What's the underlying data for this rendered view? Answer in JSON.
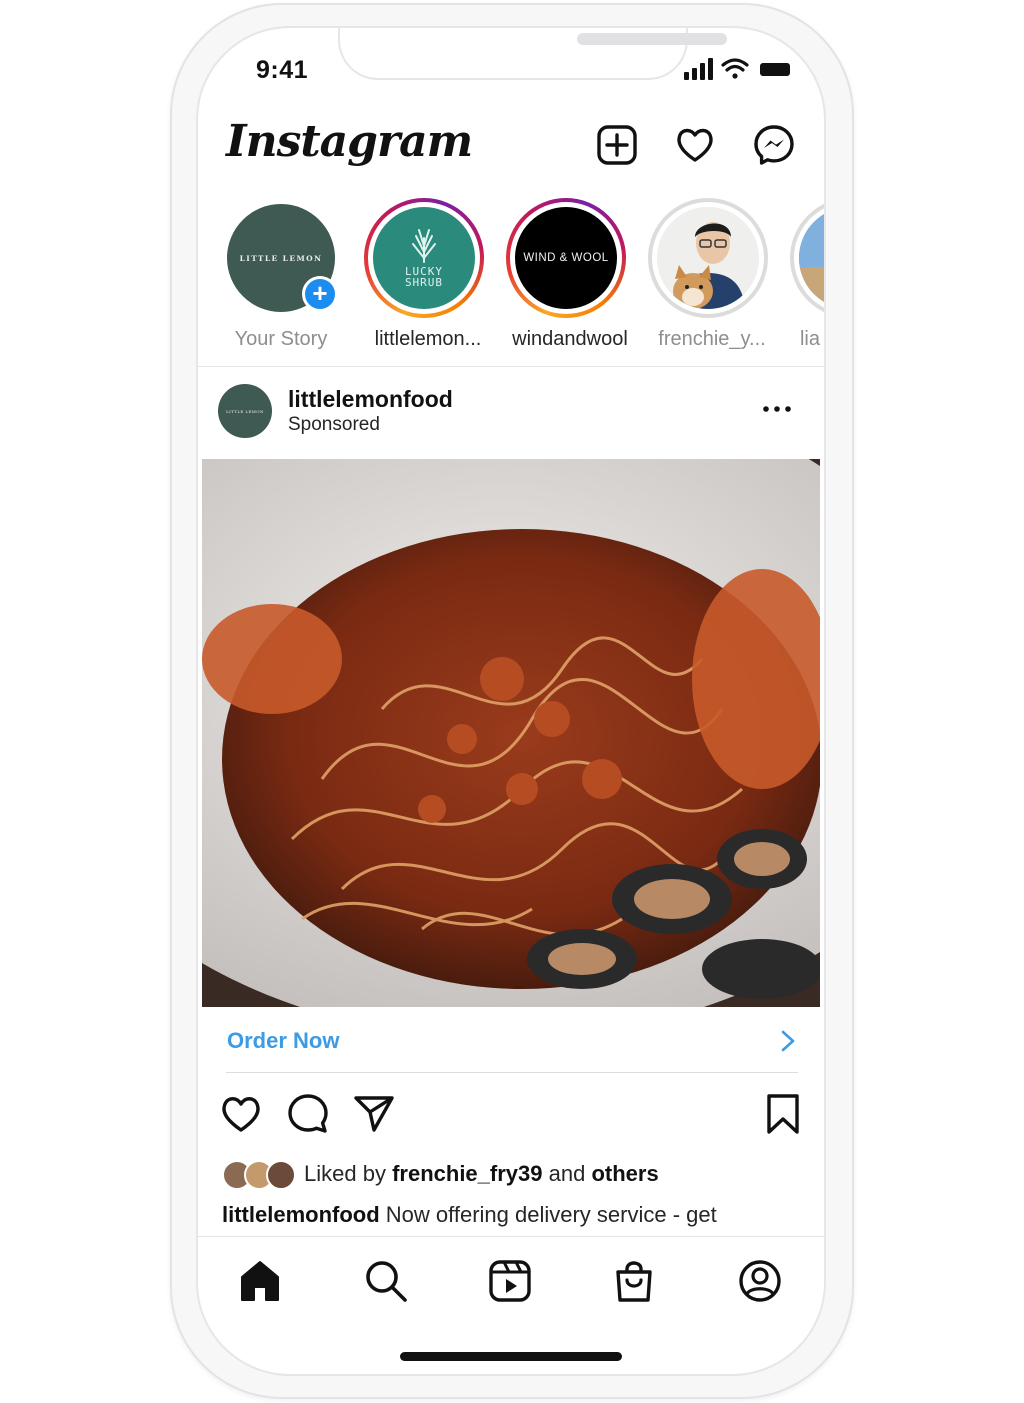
{
  "status_bar": {
    "time": "9:41"
  },
  "header": {
    "logo": "Instagram"
  },
  "stories": [
    {
      "label": "Your Story",
      "avatar_text": "LITTLE LEMON"
    },
    {
      "label": "littlelemon...",
      "avatar_text_line1": "LUCKY",
      "avatar_text_line2": "SHRUB"
    },
    {
      "label": "windandwool",
      "avatar_text": "WIND & WOOL"
    },
    {
      "label": "frenchie_y..."
    },
    {
      "label": "lia"
    }
  ],
  "post": {
    "username": "littlelemonfood",
    "subtitle": "Sponsored",
    "avatar_text": "LITTLE LEMON",
    "cta": "Order Now",
    "likes": {
      "prefix": "Liked by",
      "user": "frenchie_fry39",
      "middle": "and",
      "others": "others"
    },
    "caption": {
      "user": "littlelemonfood",
      "text": "Now offering delivery service - get"
    }
  },
  "colors": {
    "cta": "#3b9be5",
    "add_badge": "#1d8cf0",
    "little_lemon_green": "#3f5a52",
    "lucky_shrub_teal": "#2a8a7c"
  }
}
